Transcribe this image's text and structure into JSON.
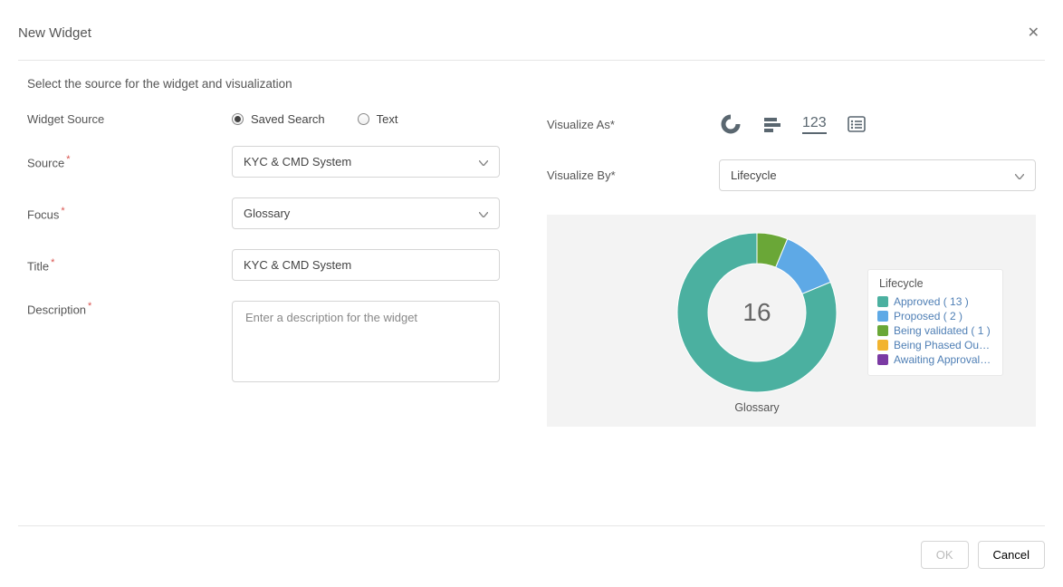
{
  "header": {
    "title": "New Widget"
  },
  "intro": "Select the source for the widget and visualization",
  "form": {
    "widget_source": {
      "label": "Widget Source",
      "options": {
        "saved_search": "Saved Search",
        "text": "Text"
      },
      "selected": "saved_search"
    },
    "source": {
      "label": "Source",
      "value": "KYC & CMD System"
    },
    "focus": {
      "label": "Focus",
      "value": "Glossary"
    },
    "title": {
      "label": "Title",
      "value": "KYC & CMD System"
    },
    "description": {
      "label": "Description",
      "placeholder": "Enter a description for the widget",
      "value": ""
    }
  },
  "right": {
    "visualize_as": {
      "label": "Visualize As"
    },
    "visualize_by": {
      "label": "Visualize By",
      "value": "Lifecycle"
    },
    "number_icon_text": "123"
  },
  "chart_data": {
    "type": "donut",
    "center_total": 16,
    "axis_label": "Glossary",
    "legend_title": "Lifecycle",
    "series": [
      {
        "name": "Approved",
        "count": 13,
        "legend": "Approved ( 13 )",
        "color": "#4bb0a0"
      },
      {
        "name": "Proposed",
        "count": 2,
        "legend": "Proposed ( 2 )",
        "color": "#5ea9e6"
      },
      {
        "name": "Being validated",
        "count": 1,
        "legend": "Being validated ( 1 )",
        "color": "#6aa737"
      },
      {
        "name": "Being Phased Out",
        "count": 0,
        "legend": "Being Phased Out …",
        "color": "#f2b430"
      },
      {
        "name": "Awaiting Approval",
        "count": 0,
        "legend": "Awaiting Approval …",
        "color": "#7b3aa3"
      }
    ]
  },
  "footer": {
    "ok": "OK",
    "cancel": "Cancel"
  }
}
